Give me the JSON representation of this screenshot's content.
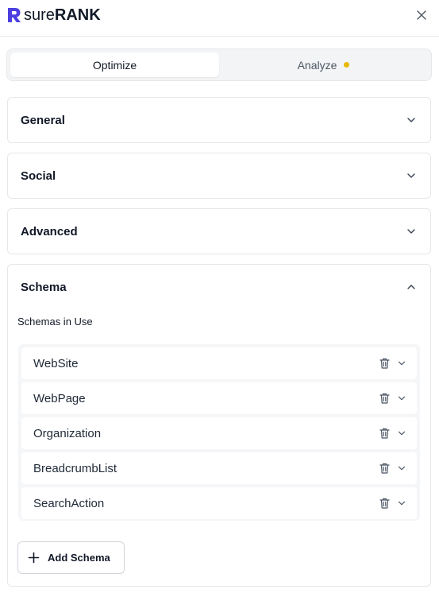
{
  "brand": {
    "name_light": "sure",
    "name_bold": "RANK",
    "accent": "#4b3fe0"
  },
  "header": {
    "close_icon": "close-icon"
  },
  "tabs": [
    {
      "label": "Optimize",
      "active": true
    },
    {
      "label": "Analyze",
      "active": false,
      "status_dot_color": "#e6b800"
    }
  ],
  "sections": [
    {
      "title": "General",
      "expanded": false
    },
    {
      "title": "Social",
      "expanded": false
    },
    {
      "title": "Advanced",
      "expanded": false
    },
    {
      "title": "Schema",
      "expanded": true
    }
  ],
  "schema": {
    "label": "Schemas in Use",
    "items": [
      {
        "name": "WebSite"
      },
      {
        "name": "WebPage"
      },
      {
        "name": "Organization"
      },
      {
        "name": "BreadcrumbList"
      },
      {
        "name": "SearchAction"
      }
    ],
    "add_button_label": "Add Schema"
  }
}
